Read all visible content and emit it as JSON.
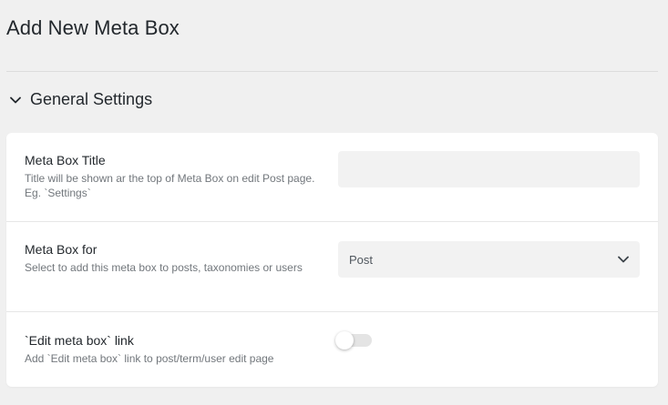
{
  "page": {
    "title": "Add New Meta Box"
  },
  "section": {
    "title": "General Settings",
    "expanded": true
  },
  "fields": [
    {
      "label": "Meta Box Title",
      "description": "Title will be shown ar the top of Meta Box on edit Post page. Eg. `Settings`",
      "value": "",
      "placeholder": ""
    },
    {
      "label": "Meta Box for",
      "description": "Select to add this meta box to posts, taxonomies or users",
      "selected": "Post"
    },
    {
      "label": "`Edit meta box` link",
      "description": "Add `Edit meta box` link to post/term/user edit page",
      "enabled": false
    }
  ],
  "icons": {
    "section_toggle": "chevron-down-icon",
    "select_arrow": "chevron-down-icon"
  },
  "colors": {
    "background": "#f0f0f0",
    "card": "#ffffff",
    "input": "#f2f2f2",
    "toggle_off": "#e4e4e4"
  }
}
